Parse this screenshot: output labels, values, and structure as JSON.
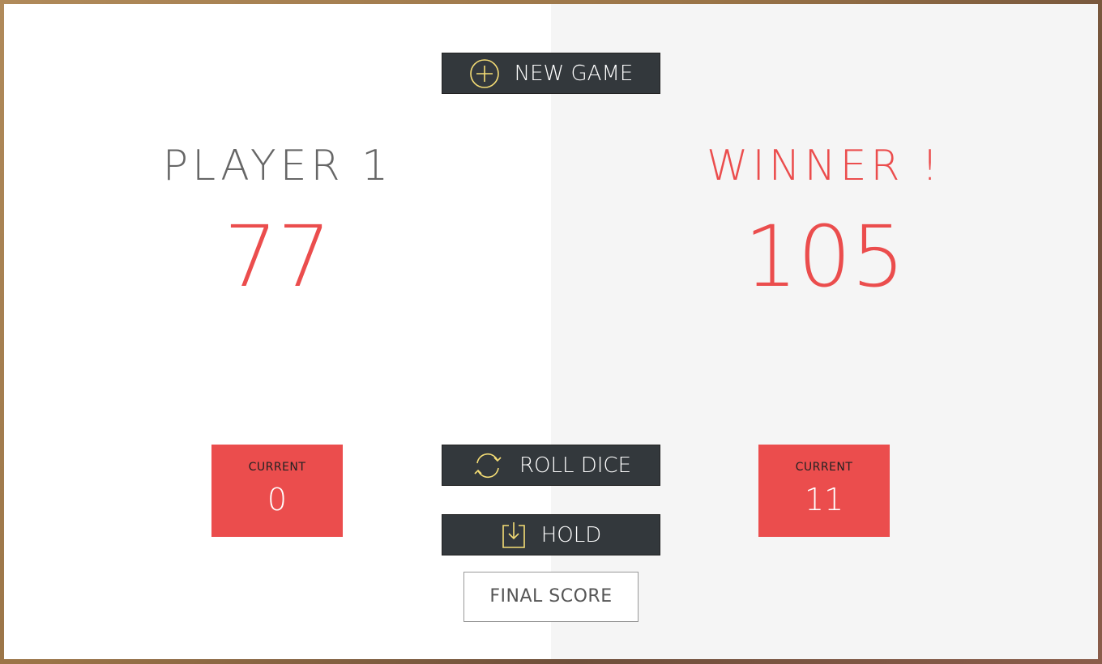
{
  "buttons": {
    "new_game": "NEW GAME",
    "roll_dice": "ROLL DICE",
    "hold": "HOLD"
  },
  "player1": {
    "name": "PLAYER 1",
    "score": "77",
    "current_label": "CURRENT",
    "current_score": "0"
  },
  "player2": {
    "name": "WINNER !",
    "score": "105",
    "current_label": "CURRENT",
    "current_score": "11"
  },
  "final_score": {
    "placeholder": "FINAL SCORE"
  },
  "icons": {
    "new_game": "plus-circle-icon",
    "roll_dice": "refresh-icon",
    "hold": "download-icon"
  },
  "colors": {
    "accent": "#EB4D4D",
    "icon": "#F5DD75",
    "button_bg": "#33383c"
  }
}
